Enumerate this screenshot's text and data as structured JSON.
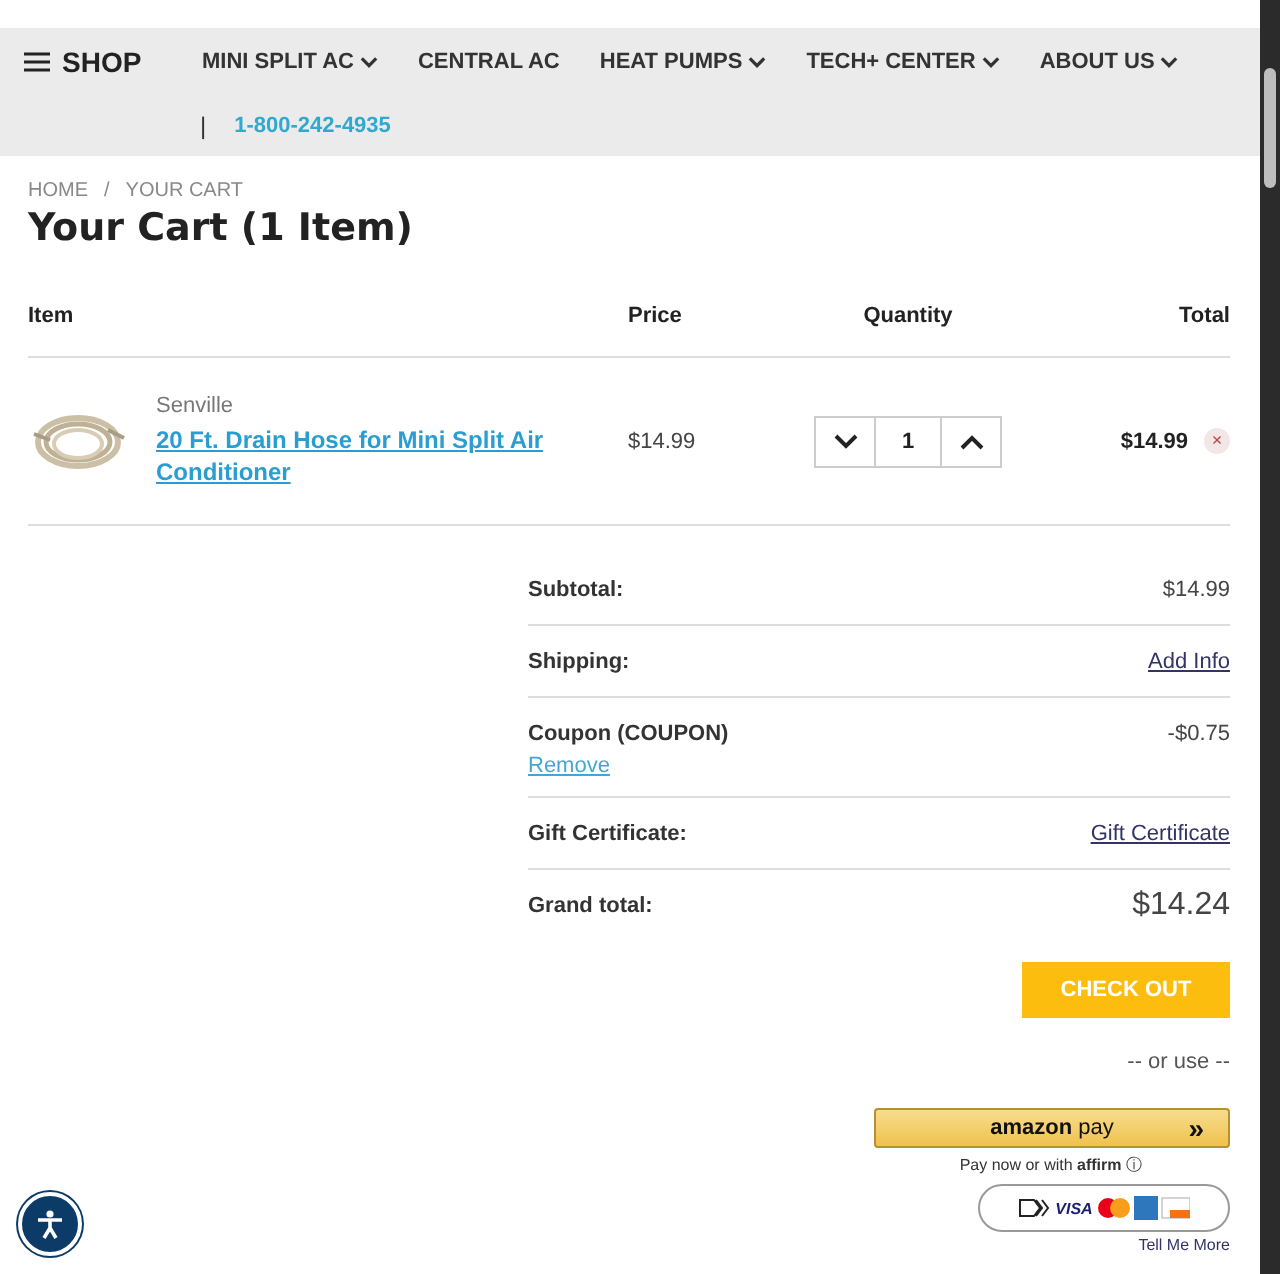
{
  "nav": {
    "menu_label": "SHOP",
    "items": [
      {
        "label": "MINI SPLIT AC",
        "has_dropdown": true
      },
      {
        "label": "CENTRAL AC",
        "has_dropdown": false
      },
      {
        "label": "HEAT PUMPS",
        "has_dropdown": true
      },
      {
        "label": "TECH+ CENTER",
        "has_dropdown": true
      },
      {
        "label": "ABOUT US",
        "has_dropdown": true
      }
    ],
    "separator": "|",
    "phone": "1-800-242-4935"
  },
  "breadcrumb": {
    "items": [
      "HOME",
      "YOUR CART"
    ],
    "separator": "/"
  },
  "title": "Your Cart (1 Item)",
  "table": {
    "columns": [
      "Item",
      "Price",
      "Quantity",
      "Total"
    ],
    "rows": [
      {
        "brand": "Senville",
        "name": "20 Ft. Drain Hose for Mini Split Air Conditioner",
        "price": "$14.99",
        "quantity": "1",
        "total": "$14.99",
        "remove": "×"
      }
    ]
  },
  "summary": [
    {
      "kind": "text",
      "label": "Subtotal:",
      "value": "$14.99"
    },
    {
      "kind": "link",
      "label": "Shipping:",
      "value": "Add Info"
    },
    {
      "kind": "coupon",
      "label": "Coupon (COUPON)",
      "value": "-$0.75",
      "action": "Remove"
    },
    {
      "kind": "link",
      "label": "Gift Certificate:",
      "value": "Gift Certificate"
    },
    {
      "kind": "grand",
      "label": "Grand total:",
      "value": "$14.24"
    }
  ],
  "checkout": "CHECK OUT",
  "or_use": "-- or use --",
  "amazon_pay": {
    "brand": "amazon",
    "word": "pay",
    "arrow": "»"
  },
  "affirm": {
    "text": "Pay now or with",
    "brand": "affirm",
    "info": "ⓘ"
  },
  "cards": {
    "visa": "VISA"
  },
  "tell_more": "Tell Me More"
}
